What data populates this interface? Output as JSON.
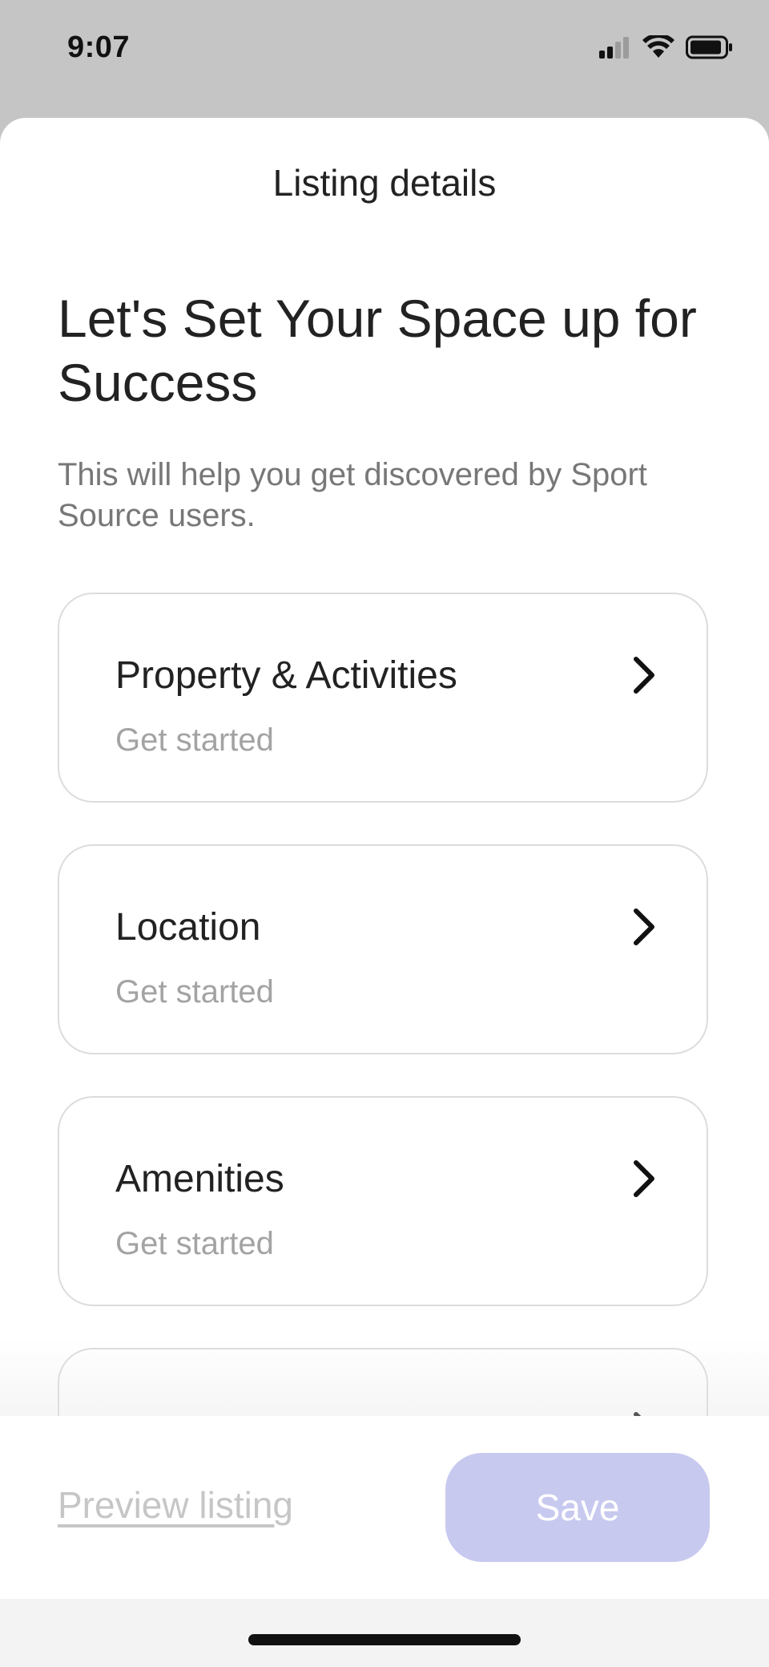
{
  "status_bar": {
    "time": "9:07",
    "icons": [
      "cellular-signal-icon",
      "wifi-icon",
      "battery-icon"
    ]
  },
  "sheet": {
    "title": "Listing details",
    "heading": "Let's Set Your Space up for Success",
    "subtitle": "This will help you get discovered by Sport Source users."
  },
  "sections": [
    {
      "title": "Property & Activities",
      "status": "Get started",
      "icon": "chevron-right-icon"
    },
    {
      "title": "Location",
      "status": "Get started",
      "icon": "chevron-right-icon"
    },
    {
      "title": "Amenities",
      "status": "Get started",
      "icon": "chevron-right-icon"
    }
  ],
  "footer": {
    "preview_label": "Preview listing",
    "save_label": "Save"
  },
  "colors": {
    "status_bar_bg": "#c4c5c4",
    "save_button_disabled": "#c8c9ef",
    "secondary_text": "#a3a3a3"
  }
}
